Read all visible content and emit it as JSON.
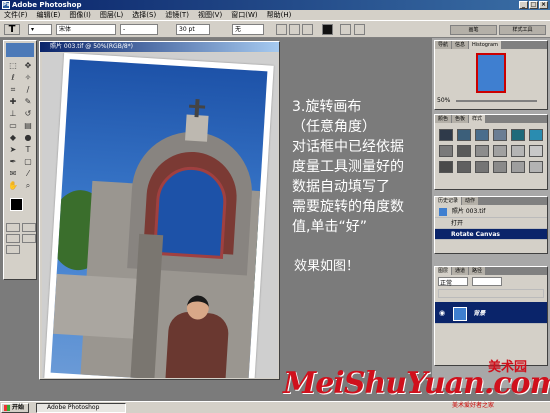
{
  "app": {
    "title": "Adobe Photoshop"
  },
  "menu": [
    "文件(F)",
    "编辑(E)",
    "图像(I)",
    "图层(L)",
    "选择(S)",
    "滤镜(T)",
    "视图(V)",
    "窗口(W)",
    "帮助(H)"
  ],
  "options": {
    "font_family": "宋体",
    "font_style": "-",
    "font_size": "30 pt",
    "antialias": "无"
  },
  "document": {
    "title": "照片 003.tif @ 50%(RGB/8*)"
  },
  "navigator": {
    "tabs": [
      "导航",
      "信息",
      "Histogram"
    ],
    "zoom": "50%"
  },
  "swatches": {
    "tabs": [
      "颜色",
      "色板",
      "样式"
    ],
    "colors": [
      "#2f3a4a",
      "#3c5f7a",
      "#4a6d8c",
      "#6b7e94",
      "#1f6a7a",
      "#2a8cb0",
      "#7a7a7a",
      "#5a5a5a",
      "#8c8c8c",
      "#a0a0a0",
      "#b4b4b4",
      "#c8c8c8",
      "#4a4a4a",
      "#606060",
      "#757575",
      "#8a8a8a",
      "#9e9e9e",
      "#b3b3b3"
    ]
  },
  "history": {
    "tabs": [
      "历史记录",
      "动作"
    ],
    "snapshot": "照片 003.tif",
    "items": [
      "打开",
      "Rotate Canvas"
    ]
  },
  "layers": {
    "tabs": [
      "图层",
      "通道",
      "路径"
    ],
    "blend": "正常",
    "layer": "背景"
  },
  "caption": {
    "lines": [
      "3.旋转画布",
      "（任意角度）",
      "对话框中已经依据",
      "度量工具测量好的",
      "数据自动填写了",
      "需要旋转的角度数",
      "值,单击“好”"
    ],
    "effect": "效果如图！"
  },
  "watermark": {
    "main": "MeiShuYuan.com",
    "chinese": "美术园",
    "sub": "美术爱好者之家"
  },
  "taskbar": {
    "start": "开始",
    "item": "Adobe Photoshop"
  }
}
